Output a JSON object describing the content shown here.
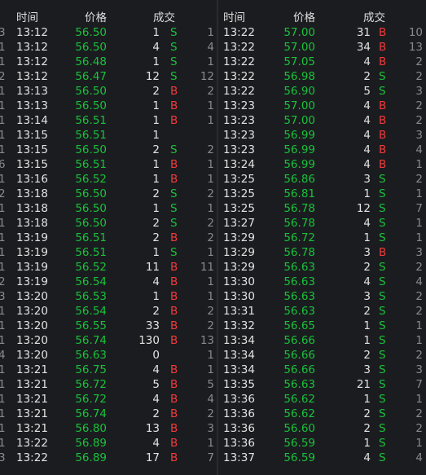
{
  "headers": {
    "time": "时间",
    "price": "价格",
    "volume": "成交"
  },
  "colors": {
    "background": "#1b1c20",
    "buy": "#f23a3a",
    "sell": "#19c23a",
    "text": "#e2e2e2",
    "muted": "#8a8a8a"
  },
  "left": [
    [
      "3",
      "13:12",
      "56.50",
      "1",
      "S",
      "1"
    ],
    [
      "1",
      "13:12",
      "56.50",
      "4",
      "S",
      "4"
    ],
    [
      "1",
      "13:12",
      "56.48",
      "1",
      "S",
      "1"
    ],
    [
      "2",
      "13:12",
      "56.47",
      "12",
      "S",
      "12"
    ],
    [
      "1",
      "13:13",
      "56.50",
      "2",
      "B",
      "2"
    ],
    [
      "1",
      "13:13",
      "56.50",
      "1",
      "B",
      "1"
    ],
    [
      "1",
      "13:14",
      "56.51",
      "1",
      "B",
      "1"
    ],
    [
      "1",
      "13:15",
      "56.51",
      "1",
      "",
      ""
    ],
    [
      "1",
      "13:15",
      "56.50",
      "2",
      "S",
      "2"
    ],
    [
      "6",
      "13:15",
      "56.51",
      "1",
      "B",
      "1"
    ],
    [
      "1",
      "13:16",
      "56.52",
      "1",
      "B",
      "1"
    ],
    [
      "2",
      "13:18",
      "56.50",
      "2",
      "S",
      "2"
    ],
    [
      "1",
      "13:18",
      "56.50",
      "1",
      "S",
      "1"
    ],
    [
      "1",
      "13:18",
      "56.50",
      "2",
      "S",
      "2"
    ],
    [
      "1",
      "13:19",
      "56.51",
      "2",
      "B",
      "2"
    ],
    [
      "1",
      "13:19",
      "56.51",
      "1",
      "S",
      "1"
    ],
    [
      "1",
      "13:19",
      "56.52",
      "11",
      "B",
      "11"
    ],
    [
      "2",
      "13:19",
      "56.54",
      "4",
      "B",
      "1"
    ],
    [
      "3",
      "13:20",
      "56.53",
      "1",
      "B",
      "1"
    ],
    [
      "1",
      "13:20",
      "56.54",
      "2",
      "B",
      "2"
    ],
    [
      "1",
      "13:20",
      "56.55",
      "33",
      "B",
      "2"
    ],
    [
      "1",
      "13:20",
      "56.74",
      "130",
      "B",
      "13"
    ],
    [
      "4",
      "13:20",
      "56.63",
      "0",
      "",
      "1"
    ],
    [
      "1",
      "13:21",
      "56.75",
      "4",
      "B",
      "1"
    ],
    [
      "1",
      "13:21",
      "56.72",
      "5",
      "B",
      "5"
    ],
    [
      "1",
      "13:21",
      "56.72",
      "4",
      "B",
      "4"
    ],
    [
      "1",
      "13:21",
      "56.74",
      "2",
      "B",
      "2"
    ],
    [
      "1",
      "13:21",
      "56.80",
      "13",
      "B",
      "3"
    ],
    [
      "1",
      "13:22",
      "56.89",
      "4",
      "B",
      "1"
    ],
    [
      "3",
      "13:22",
      "56.89",
      "17",
      "B",
      "7"
    ]
  ],
  "right": [
    [
      "13:22",
      "57.00",
      "31",
      "B",
      "10"
    ],
    [
      "13:22",
      "57.00",
      "34",
      "B",
      "13"
    ],
    [
      "13:22",
      "57.05",
      "4",
      "B",
      "2"
    ],
    [
      "13:22",
      "56.98",
      "2",
      "S",
      "2"
    ],
    [
      "13:22",
      "56.90",
      "5",
      "S",
      "3"
    ],
    [
      "13:23",
      "57.00",
      "4",
      "B",
      "2"
    ],
    [
      "13:23",
      "57.00",
      "4",
      "B",
      "2"
    ],
    [
      "13:23",
      "56.99",
      "4",
      "B",
      "3"
    ],
    [
      "13:23",
      "56.99",
      "4",
      "B",
      "4"
    ],
    [
      "13:24",
      "56.99",
      "4",
      "B",
      "1"
    ],
    [
      "13:25",
      "56.86",
      "3",
      "S",
      "2"
    ],
    [
      "13:25",
      "56.81",
      "1",
      "S",
      "1"
    ],
    [
      "13:25",
      "56.78",
      "12",
      "S",
      "7"
    ],
    [
      "13:27",
      "56.78",
      "4",
      "S",
      "1"
    ],
    [
      "13:29",
      "56.72",
      "1",
      "S",
      "1"
    ],
    [
      "13:29",
      "56.78",
      "3",
      "B",
      "3"
    ],
    [
      "13:29",
      "56.63",
      "2",
      "S",
      "2"
    ],
    [
      "13:30",
      "56.63",
      "4",
      "S",
      "4"
    ],
    [
      "13:30",
      "56.63",
      "3",
      "S",
      "2"
    ],
    [
      "13:31",
      "56.63",
      "2",
      "S",
      "2"
    ],
    [
      "13:32",
      "56.65",
      "1",
      "S",
      "1"
    ],
    [
      "13:34",
      "56.66",
      "1",
      "S",
      "1"
    ],
    [
      "13:34",
      "56.66",
      "2",
      "S",
      "2"
    ],
    [
      "13:34",
      "56.66",
      "3",
      "S",
      "3"
    ],
    [
      "13:35",
      "56.63",
      "21",
      "S",
      "7"
    ],
    [
      "13:36",
      "56.62",
      "1",
      "S",
      "1"
    ],
    [
      "13:36",
      "56.62",
      "2",
      "S",
      "2"
    ],
    [
      "13:36",
      "56.60",
      "2",
      "S",
      "2"
    ],
    [
      "13:36",
      "56.59",
      "1",
      "S",
      "1"
    ],
    [
      "13:37",
      "56.59",
      "4",
      "S",
      "4"
    ]
  ]
}
